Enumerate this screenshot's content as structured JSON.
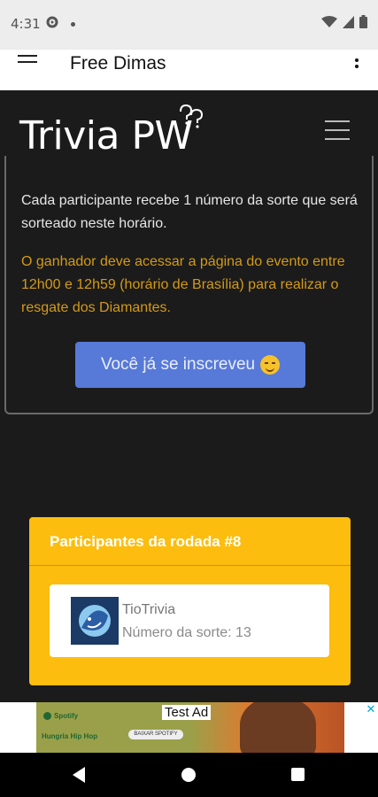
{
  "status_bar": {
    "time": "4:31",
    "icons": [
      "settings-icon",
      "notification-dot-icon",
      "wifi-icon",
      "signal-icon",
      "battery-icon"
    ]
  },
  "app_bar": {
    "title": "Free Dimas",
    "icons": [
      "menu-icon",
      "more-vert-icon"
    ]
  },
  "site": {
    "logo": "Trivia PW"
  },
  "event": {
    "text1": "Cada participante recebe 1 número da sorte que será sorteado neste horário.",
    "text2": "O ganhador deve acessar a página do evento entre 12h00 e 12h59 (horário de Brasília) para realizar o resgate dos Diamantes.",
    "button_label": "Você já se inscreveu",
    "button_emoji": "smiling-face-icon"
  },
  "participants": {
    "title": "Participantes da rodada #8",
    "items": [
      {
        "name": "TioTrivia",
        "lucky_number": "Número da sorte: 13"
      }
    ]
  },
  "ad": {
    "label": "Test Ad",
    "brand": "Spotify",
    "playlist": "Hungria Hip Hop",
    "cta": "BAIXAR SPOTIFY"
  },
  "colors": {
    "accent_button": "#5779d8",
    "highlight_text": "#d39a18",
    "participants_bg": "#fcbd0e",
    "page_bg": "#1b1b1b"
  }
}
